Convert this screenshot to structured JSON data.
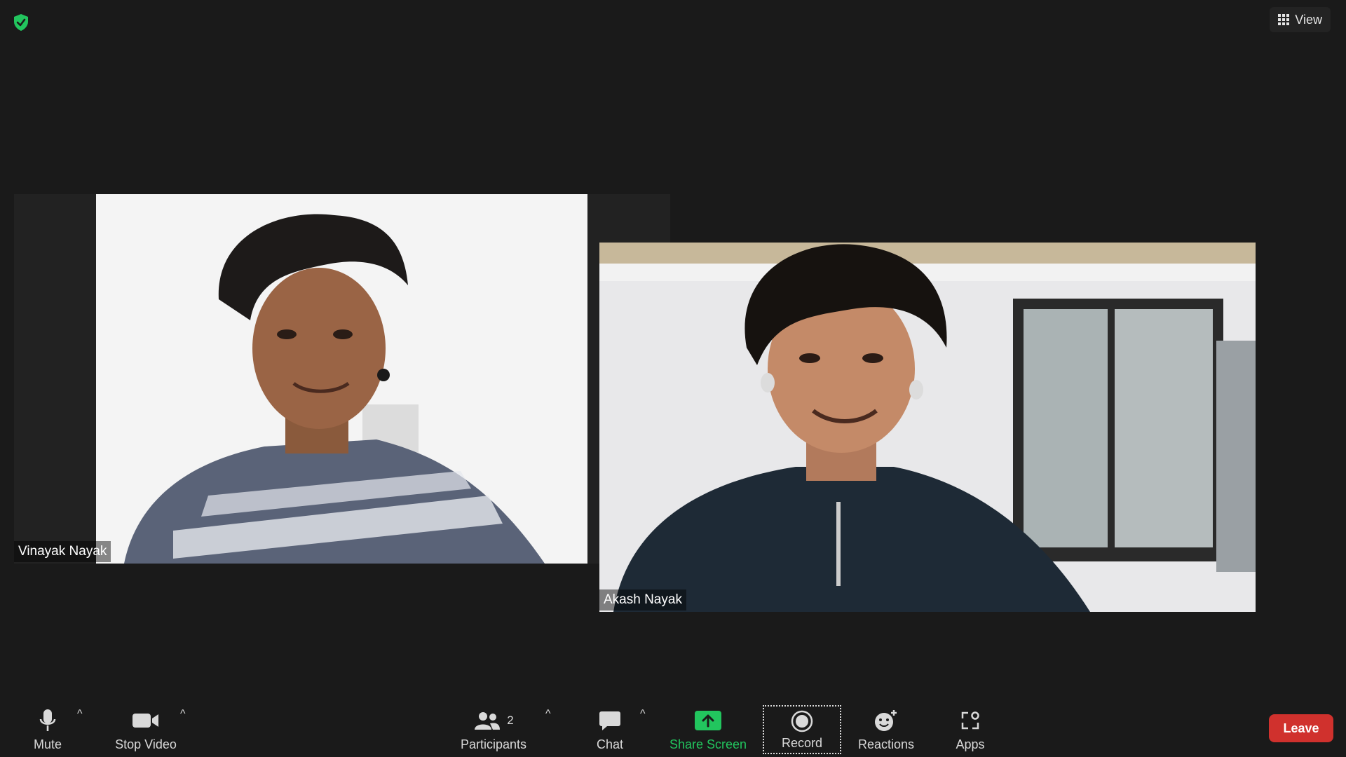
{
  "topbar": {
    "view_label": "View"
  },
  "participants_tiles": [
    {
      "name": "Vinayak Nayak"
    },
    {
      "name": "Akash Nayak"
    }
  ],
  "toolbar": {
    "mute_label": "Mute",
    "stop_video_label": "Stop Video",
    "participants_label": "Participants",
    "participants_count": "2",
    "chat_label": "Chat",
    "share_screen_label": "Share Screen",
    "record_label": "Record",
    "reactions_label": "Reactions",
    "apps_label": "Apps",
    "leave_label": "Leave",
    "caret": "^"
  },
  "colors": {
    "background": "#1a1a1a",
    "share_green": "#22c55e",
    "leave_red": "#d0312d",
    "shield_green": "#22c55e"
  },
  "icons": [
    "shield-icon",
    "grid-icon",
    "microphone-icon",
    "video-camera-icon",
    "participants-icon",
    "chat-bubble-icon",
    "share-screen-icon",
    "record-icon",
    "reactions-icon",
    "apps-icon"
  ]
}
